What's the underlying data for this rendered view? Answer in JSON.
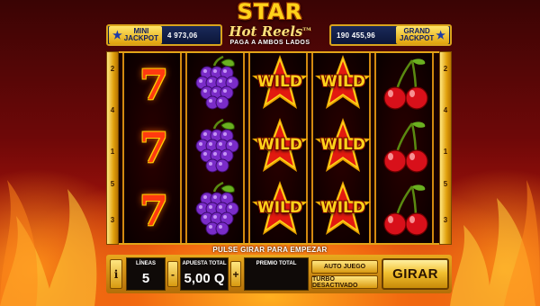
{
  "logo": {
    "word_star": "STAR",
    "word_hot": "Hot Reels",
    "tm": "TM",
    "subtitle": "PAGA A AMBOS LADOS"
  },
  "jackpots": {
    "mini": {
      "label_line1": "MINI",
      "label_line2": "JACKPOT",
      "value": "4 973,06",
      "icon": "star-icon"
    },
    "grand": {
      "label_line1": "GRAND",
      "label_line2": "JACKPOT",
      "value": "190 455,96",
      "icon": "star-icon"
    }
  },
  "paylines": {
    "left": [
      "2",
      "4",
      "1",
      "5",
      "3"
    ],
    "right": [
      "2",
      "4",
      "1",
      "5",
      "3"
    ]
  },
  "reels": [
    [
      "seven",
      "seven",
      "seven"
    ],
    [
      "grapes",
      "grapes",
      "grapes"
    ],
    [
      "wild",
      "wild",
      "wild"
    ],
    [
      "wild",
      "wild",
      "wild"
    ],
    [
      "cherries",
      "cherries",
      "cherries"
    ]
  ],
  "symbols": {
    "seven_text": "7",
    "wild_text": "WILD"
  },
  "message": "PULSE GIRAR PARA EMPEZAR",
  "controls": {
    "info_label": "i",
    "lines_label": "LÍNEAS",
    "lines_value": "5",
    "bet_label": "APUESTA TOTAL",
    "bet_value": "5,00 Q",
    "minus_label": "-",
    "plus_label": "+",
    "prize_label": "PREMIO TOTAL",
    "prize_value": "",
    "autoplay_label": "AUTO JUEGO",
    "turbo_label": "TURBO DESACTIVADO",
    "spin_label": "GIRAR"
  },
  "colors": {
    "gold": "#e2a418",
    "jackpot_panel": "#0c1638",
    "seven": "#ff3a10",
    "grape": "#7a2cc8",
    "cherry": "#d8101a",
    "wild_star": "#e21a10"
  }
}
